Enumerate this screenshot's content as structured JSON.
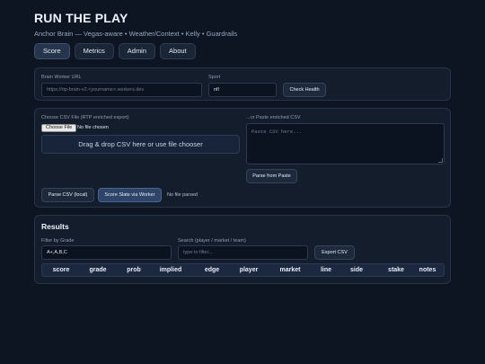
{
  "app": {
    "title": "RUN THE PLAY",
    "subtitle": "Anchor Brain — Vegas-aware • Weather/Context • Kelly • Guardrails"
  },
  "tabs": [
    {
      "label": "Score",
      "active": true
    },
    {
      "label": "Metrics",
      "active": false
    },
    {
      "label": "Admin",
      "active": false
    },
    {
      "label": "About",
      "active": false
    }
  ],
  "config": {
    "worker_url_label": "Brain Worker URL",
    "worker_url_placeholder": "https://rtp-brain-v2.<yourname>.workers.dev",
    "sport_label": "Sport",
    "sport_value": "nfl",
    "check_health_label": "Check Health"
  },
  "csv": {
    "choose_label": "Choose CSV File (RTP enriched export)",
    "choose_file_button": "Choose File",
    "file_status": "No file chosen",
    "dropzone_text": "Drag & drop CSV here or use file chooser",
    "paste_label": "...or Paste enriched CSV",
    "paste_placeholder": "Paste CSV here...",
    "parse_paste_button": "Parse from Paste",
    "parse_local_button": "Parse CSV (local)",
    "score_slate_button": "Score Slate via Worker",
    "parse_status": "No file parsed"
  },
  "results": {
    "title": "Results",
    "filter_grade_label": "Filter by Grade",
    "filter_grade_value": "A+,A,B,C",
    "search_label": "Search (player / market / team)",
    "search_placeholder": "type to filter...",
    "export_button": "Export CSV",
    "columns": [
      "score",
      "grade",
      "prob",
      "implied",
      "edge",
      "player",
      "market",
      "line",
      "side",
      "stake",
      "notes"
    ]
  },
  "colors": {
    "background": "#0d1522",
    "card": "#131d2c",
    "primary_button": "#2e4569"
  }
}
